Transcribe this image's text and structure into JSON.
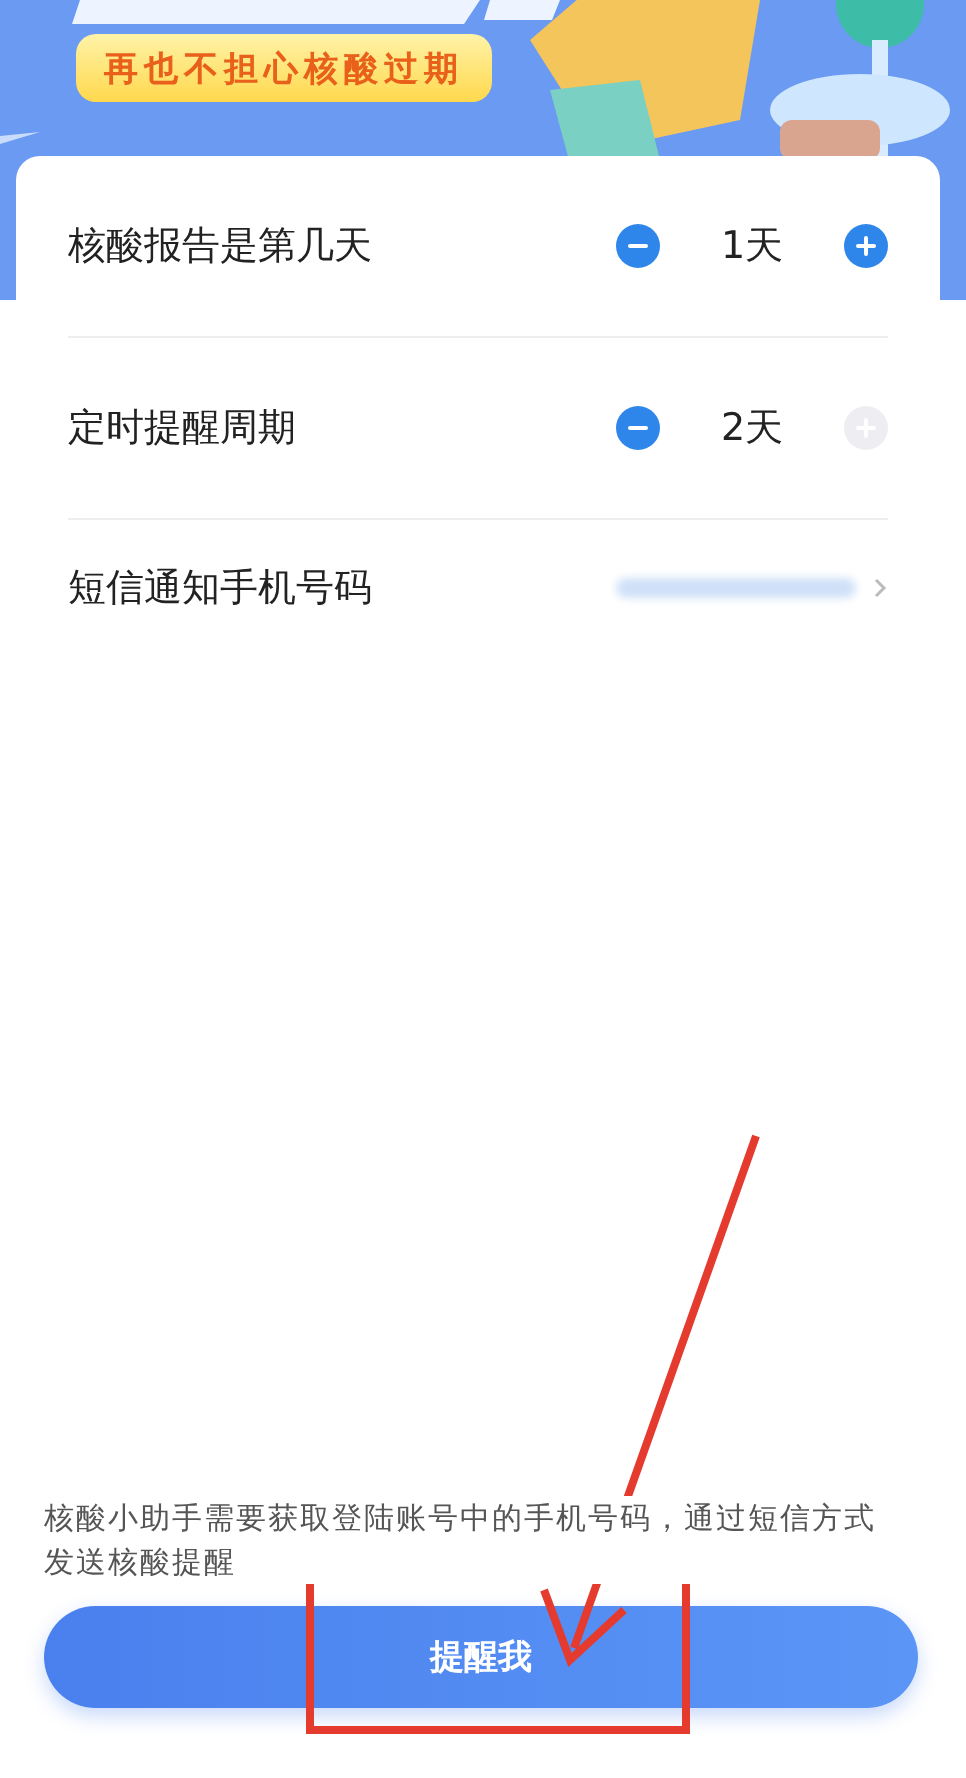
{
  "banner": {
    "subtitle": "再也不担心核酸过期"
  },
  "settings": [
    {
      "kind": "stepper",
      "label": "核酸报告是第几天",
      "value": "1天",
      "minus_disabled": false,
      "plus_disabled": false
    },
    {
      "kind": "stepper",
      "label": "定时提醒周期",
      "value": "2天",
      "minus_disabled": false,
      "plus_disabled": true
    },
    {
      "kind": "link",
      "label": "短信通知手机号码"
    }
  ],
  "notice": "核酸小助手需要获取登陆账号中的手机号码，通过短信方式发送核酸提醒",
  "primary_button": {
    "label": "提醒我"
  }
}
